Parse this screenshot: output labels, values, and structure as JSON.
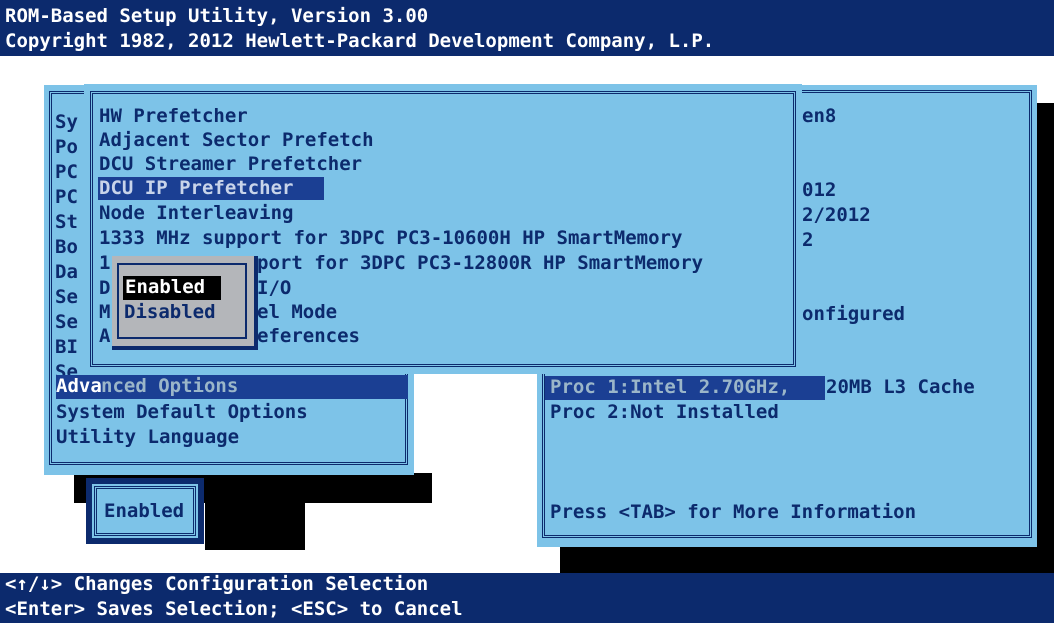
{
  "header": {
    "line1": "ROM-Based Setup Utility, Version 3.00",
    "line2": "Copyright 1982, 2012 Hewlett-Packard Development Company, L.P."
  },
  "main_menu": {
    "items_clipped": [
      "Sy",
      "Po",
      "PC",
      "PC",
      "St",
      "Bo",
      "Da",
      "Se",
      "Se",
      "BI",
      "Se"
    ],
    "advanced_hl": "Adva",
    "advanced_rest": "nced Options",
    "system_default": "System Default Options",
    "utility_language": "Utility Language"
  },
  "popup": {
    "items": [
      "HW Prefetcher",
      "Adjacent Sector Prefetch",
      "DCU Streamer Prefetcher",
      "DCU IP Prefetcher",
      "Node Interleaving",
      "1333 MHz support for 3DPC PC3-10600H HP SmartMemory",
      "1",
      "port for 3DPC PC3-12800R HP SmartMemory",
      "D",
      "I/O",
      "M",
      "el Mode",
      "A",
      "eferences"
    ],
    "selected_index": 3
  },
  "dropdown": {
    "options": [
      "Enabled",
      "Disabled"
    ],
    "selected": "Enabled"
  },
  "right_info": {
    "frag1": "en8",
    "frag2": "012",
    "frag3": "2/2012",
    "frag4": "2",
    "frag5": "onfigured",
    "proc1_dim": "Proc 1:Intel 2.70GHz,",
    "proc1_rest": "20MB L3 Cache",
    "proc2": "Proc 2:Not Installed",
    "tab_hint": "Press <TAB> for More Information"
  },
  "current_value": "Enabled",
  "footer": {
    "line1": "<↑/↓> Changes Configuration Selection",
    "line2": "<Enter> Saves Selection; <ESC> to Cancel"
  },
  "colors": {
    "navy": "#0c2a6d",
    "panel_blue": "#7dc3e8",
    "highlight": "#1b3f93"
  }
}
